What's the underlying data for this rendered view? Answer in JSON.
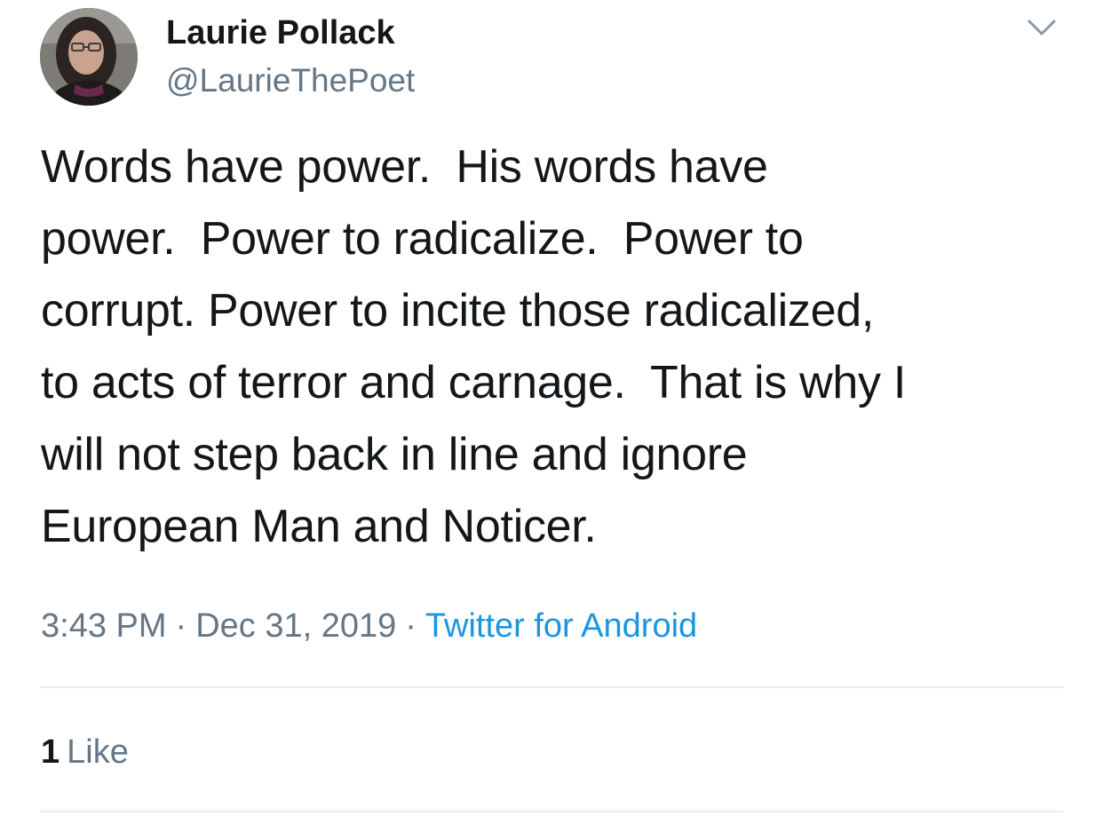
{
  "author": {
    "display_name": "Laurie Pollack",
    "handle": "@LaurieThePoet",
    "avatar_icon": "profile-photo"
  },
  "tweet": {
    "lines": [
      "Words have power.  His words have",
      "power.  Power to radicalize.  Power to",
      "corrupt. Power to incite those radicalized,",
      "to acts of terror and carnage.  That is why I",
      "will not step back in line and ignore",
      "European Man and Noticer."
    ]
  },
  "meta": {
    "time": "3:43 PM",
    "separator": "·",
    "date": "Dec 31, 2019",
    "source": "Twitter for Android"
  },
  "stats": {
    "likes_count": "1",
    "likes_label": "Like"
  },
  "menu": {
    "icon": "chevron-down-icon"
  },
  "colors": {
    "text": "#14171a",
    "secondary": "#657786",
    "link": "#1b95e0",
    "divider": "#e6ecf0"
  }
}
